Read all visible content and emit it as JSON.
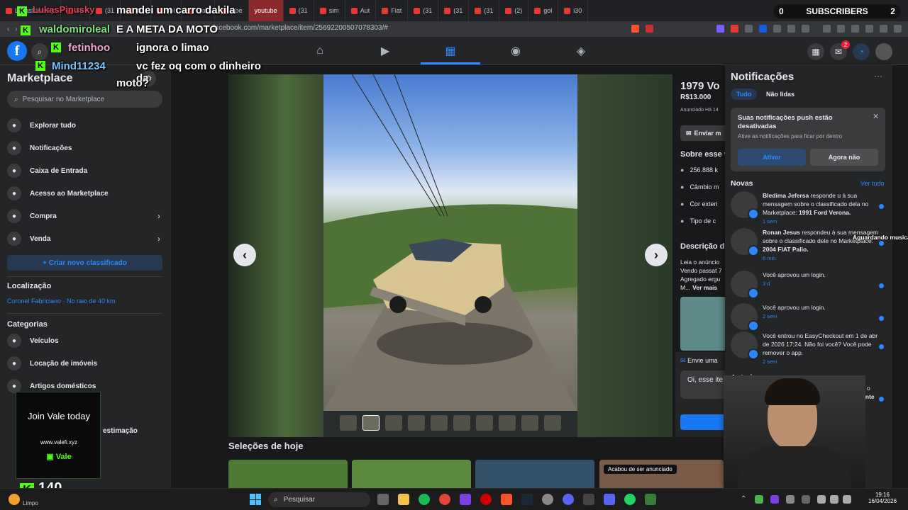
{
  "tabs": [
    {
      "label": "LukasPinusky",
      "yt": false
    },
    {
      "label": "Str",
      "yt": false
    },
    {
      "label": "(31",
      "yt": false
    },
    {
      "label": "(31",
      "yt": false
    },
    {
      "label": "Vol",
      "yt": false
    },
    {
      "label": "Blac",
      "yt": false
    },
    {
      "label": "tabe",
      "yt": false
    },
    {
      "label": "youtube",
      "yt": true
    },
    {
      "label": "(31",
      "yt": false
    },
    {
      "label": "sim",
      "yt": false
    },
    {
      "label": "Aut",
      "yt": false
    },
    {
      "label": "Fiat",
      "yt": false
    },
    {
      "label": "(31",
      "yt": false
    },
    {
      "label": "(31",
      "yt": false
    },
    {
      "label": "(31",
      "yt": false
    },
    {
      "label": "(2)",
      "yt": false
    },
    {
      "label": "gol",
      "yt": false
    },
    {
      "label": "i30",
      "yt": false
    }
  ],
  "browser": {
    "url": "facebook.com/marketplace/item/25692200507078303/#"
  },
  "subscribers": {
    "label": "SUBSCRIBERS",
    "count_left": "0",
    "count_right": "2"
  },
  "chat": {
    "messages": [
      {
        "user": "waldomiroleal",
        "text": "mandei um carro dakila"
      },
      {
        "user": "",
        "text": "E A META DA MOTO"
      },
      {
        "user": "fetinhoo",
        "text": "ignora o limao"
      },
      {
        "user": "Mind11234",
        "text": "vc fez oq com o dinheiro da"
      },
      {
        "user": "",
        "text": "moto?"
      }
    ]
  },
  "sidebar": {
    "title": "Marketplace",
    "search_placeholder": "Pesquisar no Marketplace",
    "items": [
      {
        "label": "Explorar tudo",
        "icon": "store-icon"
      },
      {
        "label": "Notificações",
        "icon": "bell-icon"
      },
      {
        "label": "Caixa de Entrada",
        "icon": "inbox-icon"
      },
      {
        "label": "Acesso ao Marketplace",
        "icon": "shield-icon"
      },
      {
        "label": "Compra",
        "icon": "bag-icon"
      },
      {
        "label": "Venda",
        "icon": "tag-icon"
      }
    ],
    "create_label": "+ Criar novo classificado",
    "location_title": "Localização",
    "location_value": "Coronel Fabriciano · No raio de 40 km",
    "categories_title": "Categorias",
    "categories": [
      {
        "label": "Veículos",
        "icon": "car-icon"
      },
      {
        "label": "Locação de imóveis",
        "icon": "home-icon"
      },
      {
        "label": "Artigos domésticos",
        "icon": "house-icon"
      }
    ],
    "extra_label": "estimação"
  },
  "promo": {
    "title": "Join Vale today",
    "url": "www.valefi.xyz",
    "brand": "Vale"
  },
  "viewer_count": "140",
  "listing": {
    "title": "1979 Vo",
    "price": "R$13.000",
    "posted": "Anunciado Há 14",
    "send_label": "Enviar m",
    "about_title": "Sobre esse v",
    "specs": [
      "256.888 k",
      "Câmbio m",
      "Cor exteri",
      "Tipo de c"
    ],
    "desc_title": "Descrição do",
    "desc_lines": [
      "Leia o anúncio",
      "Vendo passat 7",
      "Agregado ergu",
      "M..."
    ],
    "see_more": "Ver mais",
    "msg_title": "Envie uma",
    "msg_placeholder": "Oi, esse ite"
  },
  "selections_title": "Seleções de hoje",
  "toast": "Acabou de ser anunciado",
  "notifications": {
    "title": "Notificações",
    "filter_all": "Tudo",
    "filter_unread": "Não lidas",
    "push_title": "Suas notificações push estão desativadas",
    "push_sub": "Ative as notificações para ficar por dentro",
    "activate": "Ativar",
    "not_now": "Agora não",
    "section_new": "Novas",
    "see_all": "Ver tudo",
    "section_old": "Anteriores",
    "items": [
      {
        "name": "Bledima Jefersa",
        "pre": " responde u à sua mensagem sobre o classificado dela no Marketplace: ",
        "bold": "1991 Ford Verona.",
        "time": "1 sem"
      },
      {
        "name": "Ronan Jesus",
        "pre": " respondeu à sua mensagem sobre o classificado dele no Marketplace: ",
        "bold": "2004 FIAT Palio.",
        "time": "6 min"
      },
      {
        "name": "",
        "pre": "Você aprovou um login.",
        "bold": "",
        "time": "3 d"
      },
      {
        "name": "",
        "pre": "Você aprovou um login.",
        "bold": "",
        "time": "2 sem"
      },
      {
        "name": "",
        "pre": "Você entrou no EasyCheckout em 1 de abr de 2026 17:24. Não foi você? Você pode remover o app.",
        "bold": "",
        "time": "2 sem"
      },
      {
        "name": "Ka",
        "pre": " respondeu à sua mensagem sobre o classificado dele no Marketplace: ",
        "bold": "Volante Logitech...",
        "time": ""
      }
    ]
  },
  "music_overlay": "Aguardando musica",
  "messenger_badge": "2",
  "taskbar": {
    "weather": "Limpo",
    "search": "Pesquisar",
    "time": "19:16",
    "date": "16/04/2026"
  }
}
